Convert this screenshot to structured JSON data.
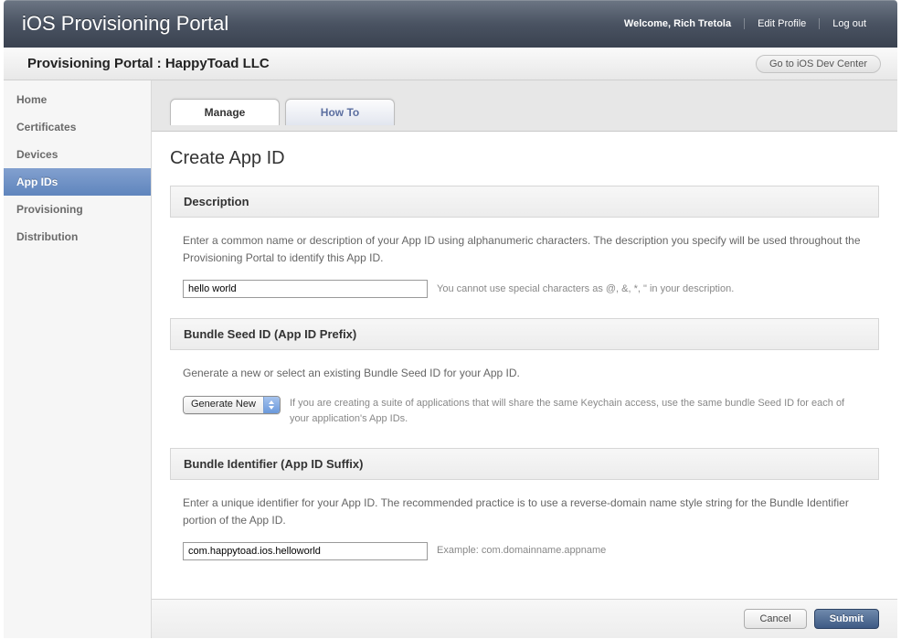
{
  "header": {
    "title": "iOS Provisioning Portal",
    "welcome": "Welcome, Rich Tretola",
    "edit_profile": "Edit Profile",
    "logout": "Log out"
  },
  "subheader": {
    "title": "Provisioning Portal : HappyToad LLC",
    "dev_center": "Go to iOS Dev Center"
  },
  "sidebar": {
    "items": [
      {
        "label": "Home"
      },
      {
        "label": "Certificates"
      },
      {
        "label": "Devices"
      },
      {
        "label": "App IDs"
      },
      {
        "label": "Provisioning"
      },
      {
        "label": "Distribution"
      }
    ]
  },
  "tabs": {
    "manage": "Manage",
    "howto": "How To"
  },
  "page": {
    "title": "Create App ID",
    "sections": {
      "description": {
        "heading": "Description",
        "text": "Enter a common name or description of your App ID using alphanumeric characters. The description you specify will be used throughout the Provisioning Portal to identify this App ID.",
        "input_value": "hello world",
        "hint": "You cannot use special characters as @, &, *, \" in your description."
      },
      "seed": {
        "heading": "Bundle Seed ID (App ID Prefix)",
        "text": "Generate a new or select an existing Bundle Seed ID for your App ID.",
        "select_value": "Generate New",
        "hint": "If you are creating a suite of applications that will share the same Keychain access, use the same bundle Seed ID for each of your application's App IDs."
      },
      "identifier": {
        "heading": "Bundle Identifier (App ID Suffix)",
        "text": "Enter a unique identifier for your App ID. The recommended practice is to use a reverse-domain name style string for the Bundle Identifier portion of the App ID.",
        "input_value": "com.happytoad.ios.helloworld",
        "hint": "Example: com.domainname.appname"
      }
    },
    "buttons": {
      "cancel": "Cancel",
      "submit": "Submit"
    }
  }
}
